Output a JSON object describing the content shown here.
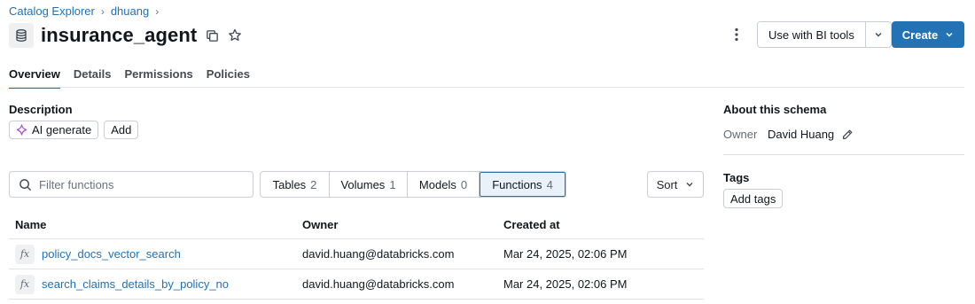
{
  "breadcrumb": {
    "items": [
      "Catalog Explorer",
      "dhuang"
    ],
    "separator": "›"
  },
  "header": {
    "title": "insurance_agent",
    "more_icon": "kebab-icon",
    "bi_tools_label": "Use with BI tools",
    "create_label": "Create"
  },
  "tabs": [
    {
      "label": "Overview",
      "active": true
    },
    {
      "label": "Details",
      "active": false
    },
    {
      "label": "Permissions",
      "active": false
    },
    {
      "label": "Policies",
      "active": false
    }
  ],
  "description": {
    "label": "Description",
    "ai_generate_label": "AI generate",
    "add_label": "Add"
  },
  "filter": {
    "placeholder": "Filter functions",
    "value": ""
  },
  "segments": [
    {
      "label": "Tables",
      "count": "2",
      "active": false
    },
    {
      "label": "Volumes",
      "count": "1",
      "active": false
    },
    {
      "label": "Models",
      "count": "0",
      "active": false
    },
    {
      "label": "Functions",
      "count": "4",
      "active": true
    }
  ],
  "sort_label": "Sort",
  "table": {
    "columns": [
      "Name",
      "Owner",
      "Created at"
    ],
    "rows": [
      {
        "name": "policy_docs_vector_search",
        "owner": "david.huang@databricks.com",
        "created": "Mar 24, 2025, 02:06 PM"
      },
      {
        "name": "search_claims_details_by_policy_no",
        "owner": "david.huang@databricks.com",
        "created": "Mar 24, 2025, 02:06 PM"
      }
    ]
  },
  "sidebar": {
    "about_title": "About this schema",
    "owner_label": "Owner",
    "owner_name": "David Huang",
    "tags_title": "Tags",
    "add_tags_label": "Add tags"
  },
  "colors": {
    "accent": "#2272b4",
    "ai_icon": "#b04ad3",
    "border": "#c9ced4"
  }
}
